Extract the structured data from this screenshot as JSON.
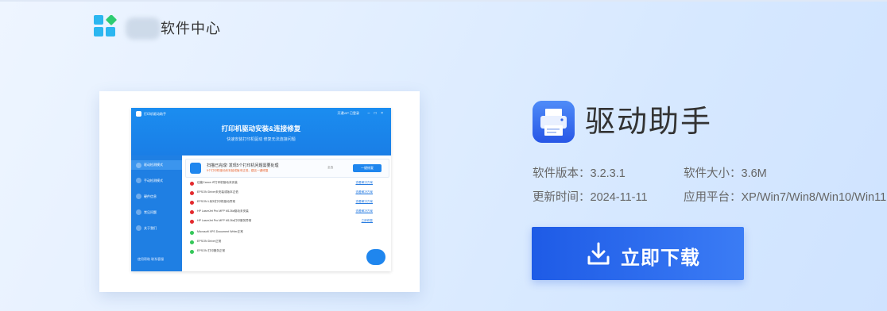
{
  "header": {
    "brand_suffix": "软件中心",
    "accent": "#2bb6f0",
    "logo_green": "#2ecc71"
  },
  "preview": {
    "app_title": "打印机驱动助手",
    "banner_title": "打印机驱动安装&连接修复",
    "banner_sub": "快速安装打印机驱动    修复无法连接问题",
    "login": "开通VIP  已登录",
    "win_controls": "–  □  ×",
    "sidebar": [
      "驱动检测模式",
      "手动检测模式",
      "硬件信息",
      "常见问题",
      "关于我们"
    ],
    "sidebar_footer": "使用帮助  联系客服",
    "scan_title": "扫描已完成! 发现5个打印机问题需要处理",
    "scan_note": "5个打印机驱动未安装或版本过低，建议一键修复",
    "scan_check": "全选",
    "scan_button": "一键修复",
    "rows": [
      {
        "status": "error",
        "text": "佳能Canon iP打印机驱动未安装",
        "link": "查看解决方案"
      },
      {
        "status": "error",
        "text": "EPSON Driver未安装或版本过低",
        "link": "查看解决方案"
      },
      {
        "status": "error",
        "text": "EPSON L系列打印机驱动异常",
        "link": "查看解决方案"
      },
      {
        "status": "error",
        "text": "HP LaserJet Pro MFP M126a驱动未安装",
        "link": "查看解决方案"
      },
      {
        "status": "error",
        "text": "HP LaserJet Pro MFP M126a打印服务异常",
        "link": "立即修复"
      },
      {
        "status": "ok",
        "text": "Microsoft XPS Document Writer正常"
      },
      {
        "status": "ok",
        "text": "EPSON Driver正常"
      },
      {
        "status": "ok",
        "text": "EPSON 打印服务正常"
      }
    ]
  },
  "product": {
    "name": "驱动助手",
    "version_label": "软件版本：3.2.3.1",
    "size_label": "软件大小：3.6M",
    "update_label": "更新时间：2024-11-11",
    "platform_label": "应用平台：XP/Win7/Win8/Win10/Win11",
    "download_label": "立即下载",
    "button_color": "#2563eb"
  }
}
